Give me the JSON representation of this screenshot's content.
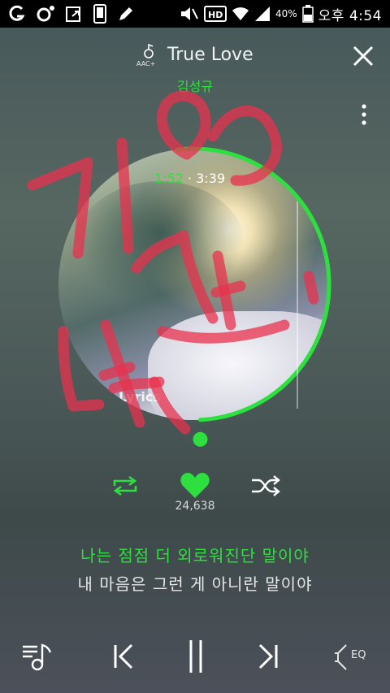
{
  "status_bar": {
    "battery_pct": "40%",
    "time": "오후 4:54",
    "left_icons": [
      "g-icon",
      "circle-dot-icon",
      "share-icon",
      "phone-icon",
      "pen-icon"
    ],
    "right_icons": [
      "mute-icon",
      "hd-icon",
      "wifi-icon",
      "signal-icon",
      "battery-icon"
    ]
  },
  "player": {
    "codec": "AAC+",
    "title": "True Love",
    "artist": "김성규",
    "current_time": "1:52",
    "separator": "·",
    "total_time": "3:39",
    "progress_fraction": 0.511,
    "likes": "24,638",
    "accent_color": "#2ee03f"
  },
  "album_art": {
    "watermark_text": "Lyrics"
  },
  "lyrics": {
    "current": "나는 점점 더 외로워진단 말이야",
    "next": "내 마음은 그런 게 아니란 말이야"
  },
  "controls": {
    "eq_label": "EQ",
    "icons": [
      "playlist-icon",
      "previous-icon",
      "pause-icon",
      "next-icon",
      "eq-icon",
      "repeat-icon",
      "heart-icon",
      "shuffle-icon"
    ]
  },
  "scribble_overlay": {
    "color": "#e8324e",
    "text": "기억 선 넷"
  }
}
